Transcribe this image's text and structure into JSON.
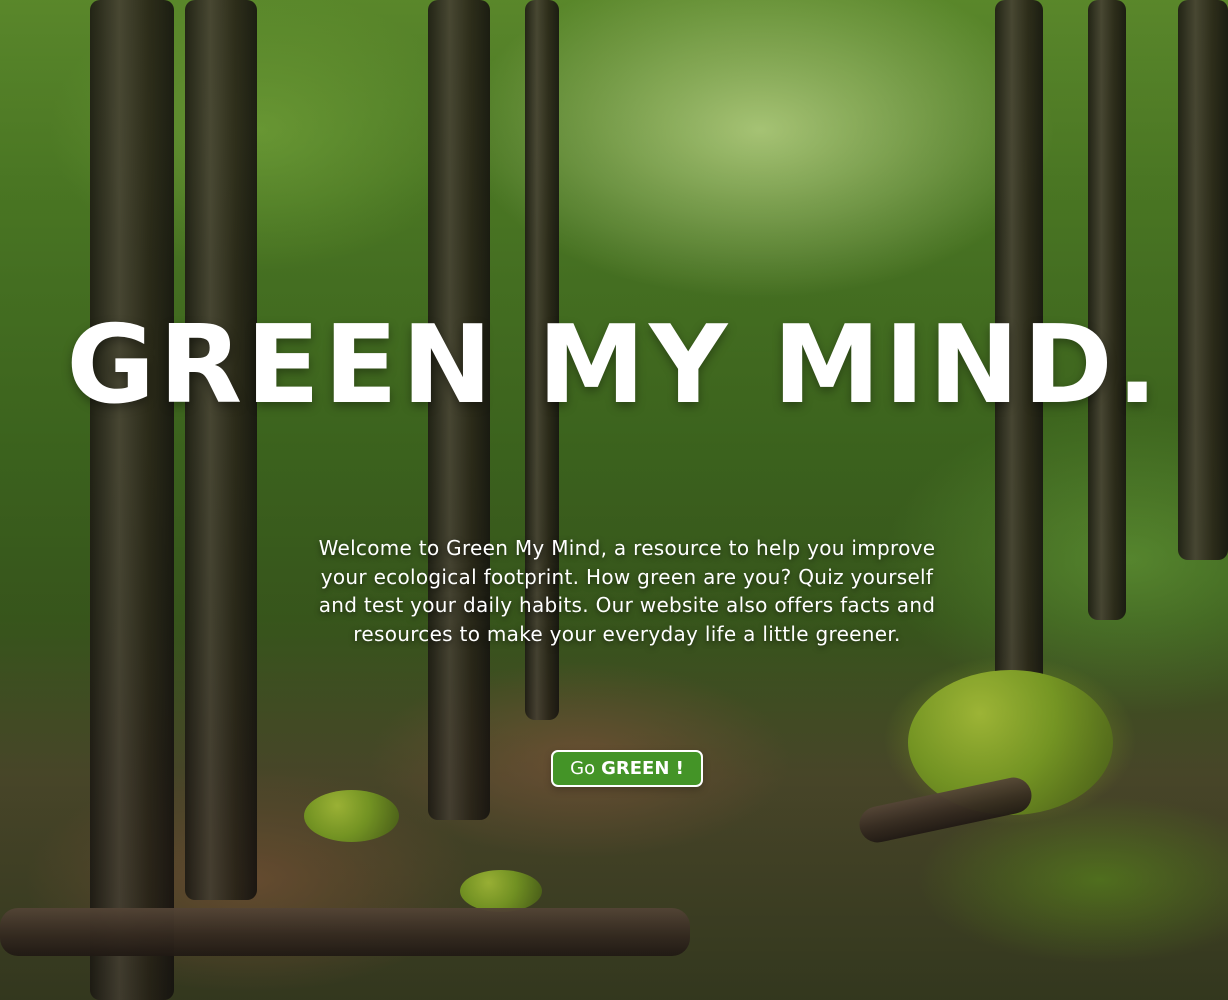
{
  "hero": {
    "title": "GREEN MY MIND.",
    "intro": "Welcome to Green My Mind, a resource to help you improve your ecological footprint. How green are you? Quiz yourself and test your daily habits. Our website also offers facts and resources to make your everyday life a little greener.",
    "cta": {
      "prefix": "Go",
      "emphasis": "GREEN !"
    }
  },
  "colors": {
    "button_background": "#449427",
    "text": "#ffffff"
  }
}
